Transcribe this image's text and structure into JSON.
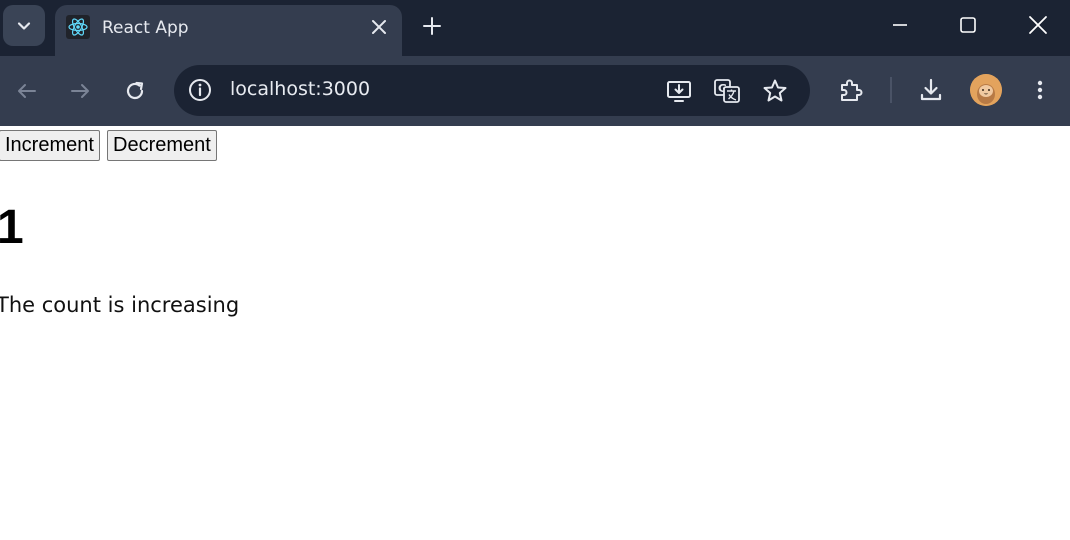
{
  "browser": {
    "tab": {
      "title": "React App",
      "favicon": "react-atom-icon"
    },
    "address_bar": {
      "url": "localhost:3000"
    },
    "icons": {
      "tab_search": "chevron-down-icon",
      "new_tab": "plus-icon",
      "back": "arrow-left-icon",
      "forward": "arrow-right-icon",
      "reload": "reload-icon",
      "site_info": "info-icon",
      "install": "install-app-icon",
      "translate": "translate-icon",
      "bookmark": "star-icon",
      "extensions": "puzzle-icon",
      "downloads": "download-icon",
      "profile": "avatar",
      "menu": "more-vert-icon",
      "minimize": "minimize-icon",
      "maximize": "maximize-icon",
      "close": "close-icon"
    },
    "colors": {
      "titlebar": "#1b2333",
      "toolbar": "#343d4f",
      "omnibox": "#1b2333"
    }
  },
  "page": {
    "buttons": {
      "increment": "Increment",
      "decrement": "Decrement"
    },
    "count": "1",
    "status": "The count is increasing"
  }
}
